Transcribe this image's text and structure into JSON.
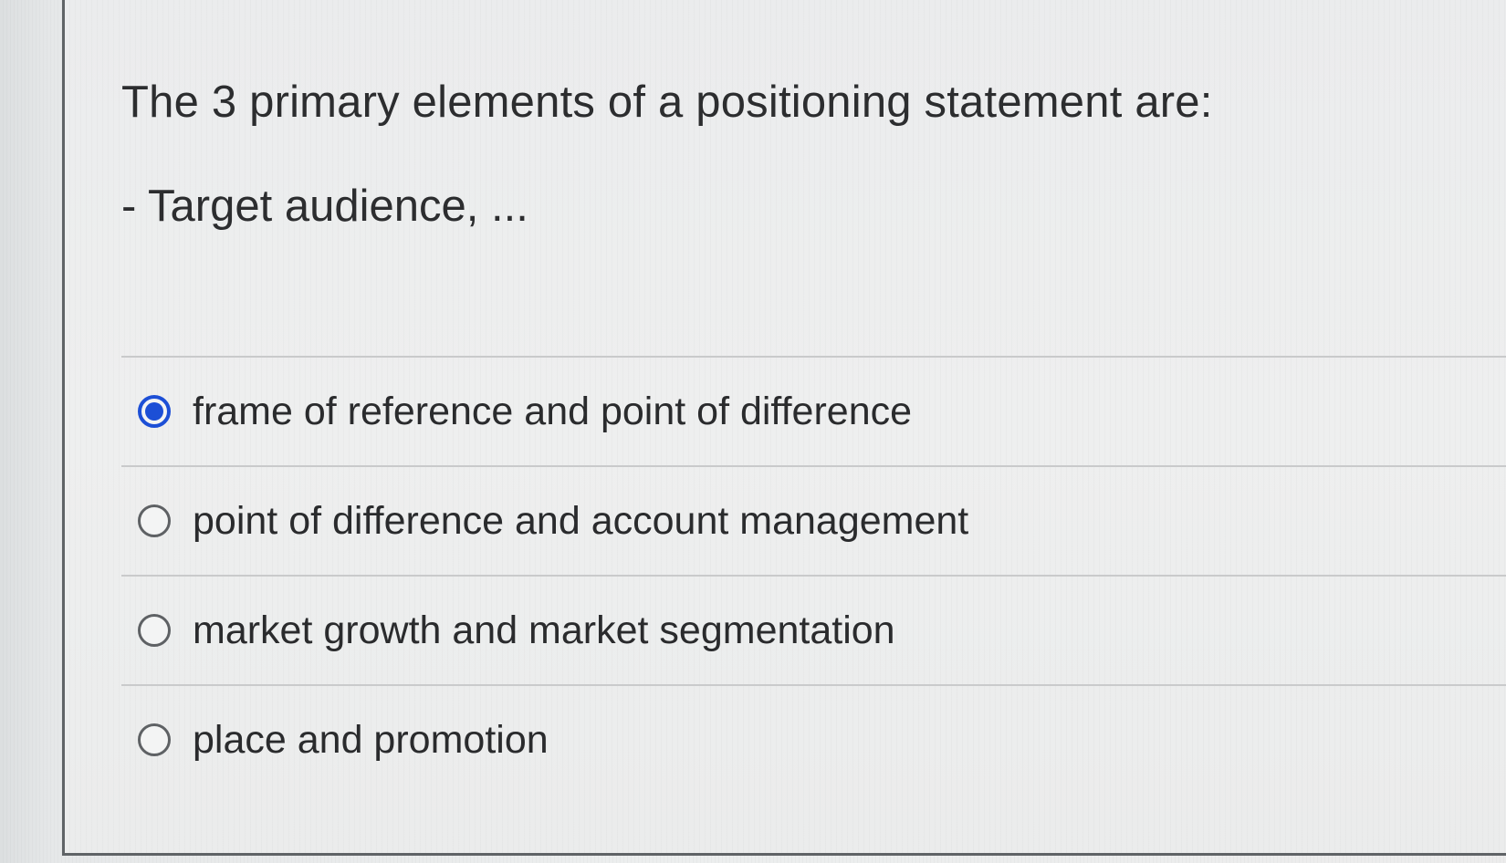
{
  "question": {
    "prompt": "The 3 primary elements of a positioning statement are:",
    "hint": "- Target audience, ..."
  },
  "answers": [
    {
      "label": "frame of reference and point of difference",
      "selected": true
    },
    {
      "label": "point of difference and account management",
      "selected": false
    },
    {
      "label": "market growth and market segmentation",
      "selected": false
    },
    {
      "label": "place and promotion",
      "selected": false
    }
  ],
  "colors": {
    "selected_radio": "#1c4fd6",
    "text": "#2c2d2f",
    "divider": "#c9cacb"
  }
}
